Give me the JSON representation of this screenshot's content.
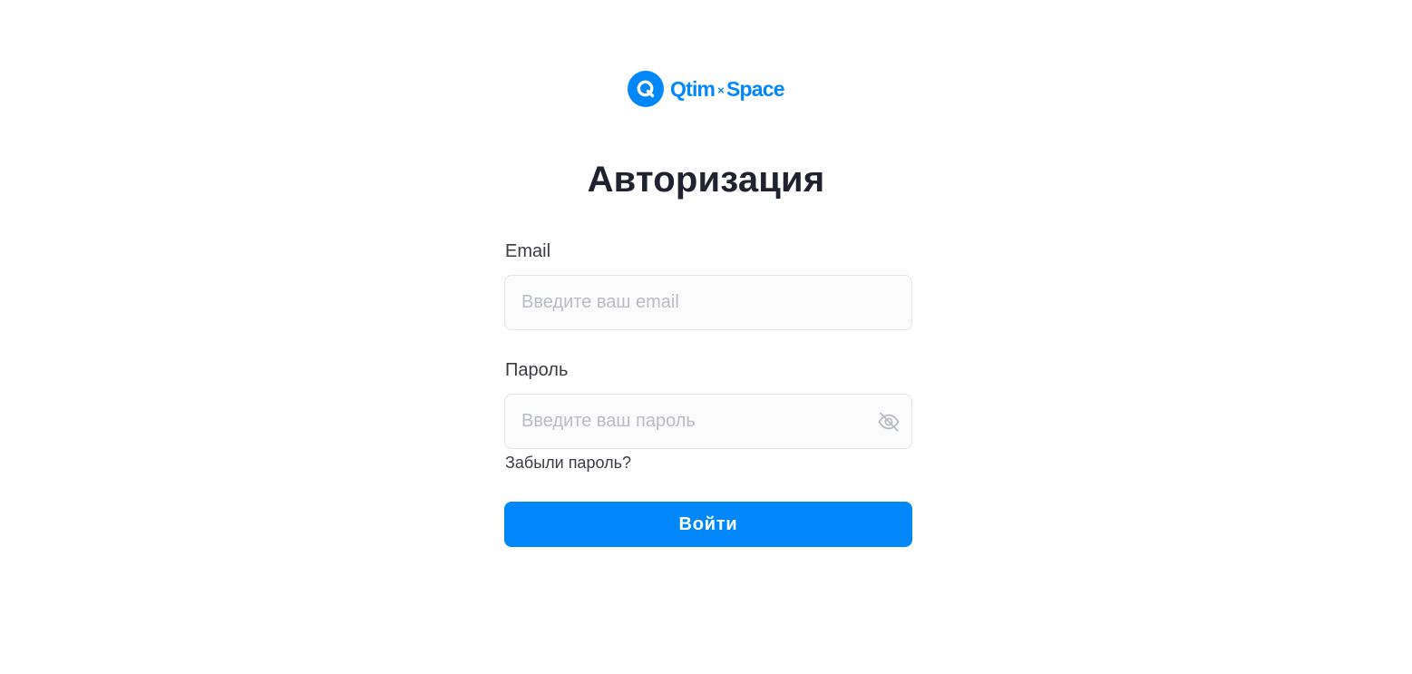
{
  "logo": {
    "brand_left": "Qtim",
    "separator": "×",
    "brand_right": "Space",
    "mark_icon": "q-logo-icon",
    "color": "#0088fb"
  },
  "title": "Авторизация",
  "email": {
    "label": "Email",
    "placeholder": "Введите ваш email",
    "value": ""
  },
  "password": {
    "label": "Пароль",
    "placeholder": "Введите ваш пароль",
    "value": "",
    "toggle_icon": "eye-off-icon"
  },
  "forgot_link": "Забыли пароль?",
  "submit_label": "Войти",
  "colors": {
    "accent": "#0088fb",
    "title": "#20222f",
    "placeholder": "#b9bcc5",
    "input_border": "#e3e5ea"
  }
}
